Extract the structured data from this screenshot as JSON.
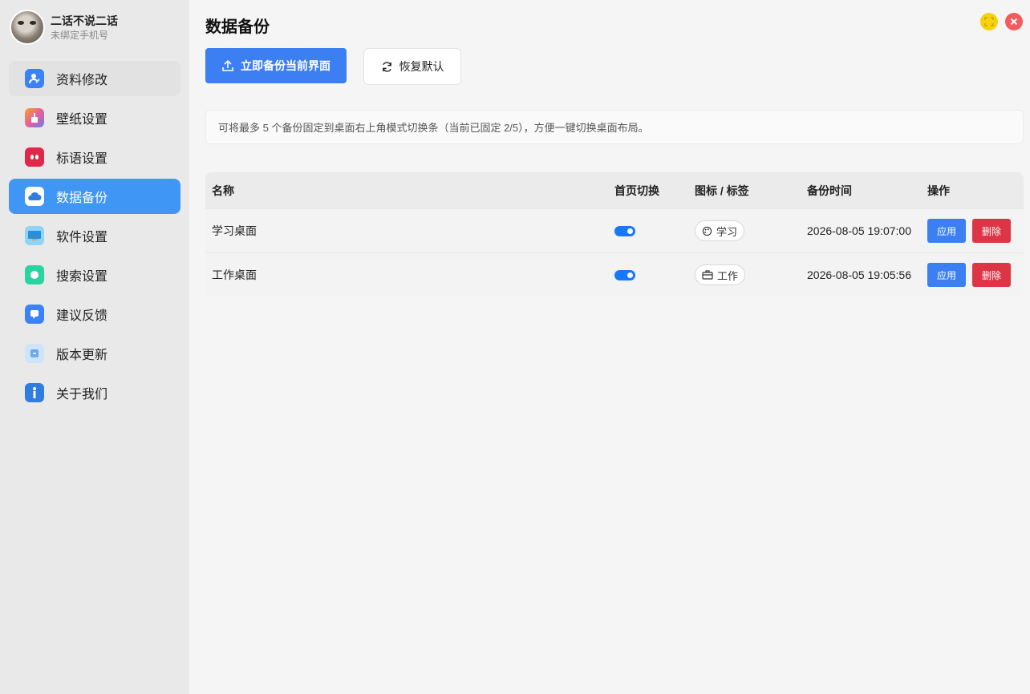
{
  "profile": {
    "username": "二话不说二话",
    "subtitle": "未绑定手机号"
  },
  "sidebar": {
    "items": [
      {
        "label": "资料修改",
        "icon": "user-edit-icon",
        "color": "#3b82f6"
      },
      {
        "label": "壁纸设置",
        "icon": "wallpaper-icon",
        "color": "#e85d9a"
      },
      {
        "label": "标语设置",
        "icon": "quote-icon",
        "color": "#e0284a"
      },
      {
        "label": "数据备份",
        "icon": "cloud-icon",
        "color": "#3b82f6"
      },
      {
        "label": "软件设置",
        "icon": "monitor-icon",
        "color": "#48b8e8"
      },
      {
        "label": "搜索设置",
        "icon": "search-bubble-icon",
        "color": "#2ad4a0"
      },
      {
        "label": "建议反馈",
        "icon": "feedback-icon",
        "color": "#3b82f6"
      },
      {
        "label": "版本更新",
        "icon": "update-icon",
        "color": "#6aa8f0"
      },
      {
        "label": "关于我们",
        "icon": "info-icon",
        "color": "#2f7de0"
      }
    ]
  },
  "main": {
    "title": "数据备份",
    "backup_button": "立即备份当前界面",
    "restore_button": "恢复默认",
    "info_text": "可将最多 5 个备份固定到桌面右上角模式切换条（当前已固定 2/5），方便一键切换桌面布局。"
  },
  "table": {
    "headers": {
      "name": "名称",
      "toggle": "首页切换",
      "tag": "图标 / 标签",
      "time": "备份时间",
      "ops": "操作"
    },
    "rows": [
      {
        "name": "学习桌面",
        "toggle_on": true,
        "tag": "学习",
        "tag_icon": "palette-icon",
        "time": "2026-08-05 19:07:00",
        "apply": "应用",
        "delete": "删除"
      },
      {
        "name": "工作桌面",
        "toggle_on": true,
        "tag": "工作",
        "tag_icon": "briefcase-icon",
        "time": "2026-08-05 19:05:56",
        "apply": "应用",
        "delete": "删除"
      }
    ]
  },
  "colors": {
    "primary": "#3b7ff2",
    "danger": "#dc3545",
    "active_nav": "#4096f5",
    "fullscreen_btn": "#f5d20a",
    "close_btn": "#f25c5c"
  }
}
